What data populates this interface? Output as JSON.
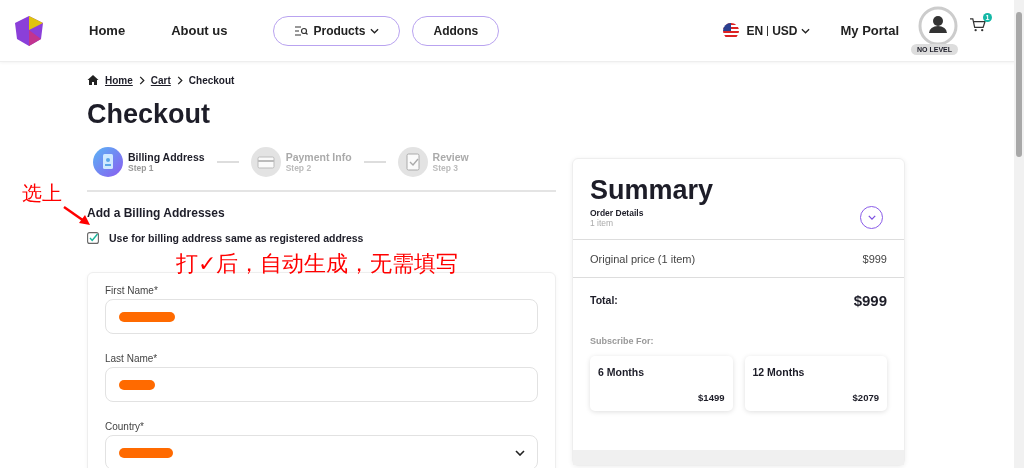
{
  "header": {
    "nav": [
      {
        "label": "Home",
        "kind": "link"
      },
      {
        "label": "About us",
        "kind": "link"
      },
      {
        "label": "Products",
        "kind": "menu"
      },
      {
        "label": "Addons",
        "kind": "pill"
      }
    ],
    "language": "EN",
    "currency": "USD",
    "portal": "My Portal",
    "level_badge": "NO LEVEL",
    "cart_count": "1"
  },
  "breadcrumb": [
    {
      "label": "Home",
      "kind": "link"
    },
    {
      "label": "Cart",
      "kind": "link"
    },
    {
      "label": "Checkout",
      "kind": "current"
    }
  ],
  "title": "Checkout",
  "steps": [
    {
      "label": "Billing Address",
      "sub": "Step 1",
      "active": true,
      "kind": "address"
    },
    {
      "label": "Payment Info",
      "sub": "Step 2",
      "active": false,
      "kind": "card"
    },
    {
      "label": "Review",
      "sub": "Step 3",
      "active": false,
      "kind": "review"
    }
  ],
  "section_title": "Add a Billing Addresses",
  "same_address": {
    "label": "Use for billing address same as registered address",
    "checked": true
  },
  "fields": [
    {
      "label": "First Name*",
      "kind": "text"
    },
    {
      "label": "Last Name*",
      "kind": "text"
    },
    {
      "label": "Country*",
      "kind": "select"
    }
  ],
  "annotations": [
    {
      "text": "选上",
      "kind": "arrow"
    },
    {
      "text": "打✓后，自动生成，无需填写",
      "kind": "note"
    }
  ],
  "summary": {
    "title": "Summary",
    "subtitle": "Order Details",
    "count": "1 item",
    "rows": [
      {
        "label": "Original price (1 item)",
        "value": "$999",
        "kind": "line"
      },
      {
        "label": "Total:",
        "value": "$999",
        "kind": "total"
      }
    ],
    "subscribe_label": "Subscribe For:",
    "plans": [
      {
        "name": "6 Months",
        "price": "$1499"
      },
      {
        "name": "12 Months",
        "price": "$2079"
      }
    ]
  }
}
